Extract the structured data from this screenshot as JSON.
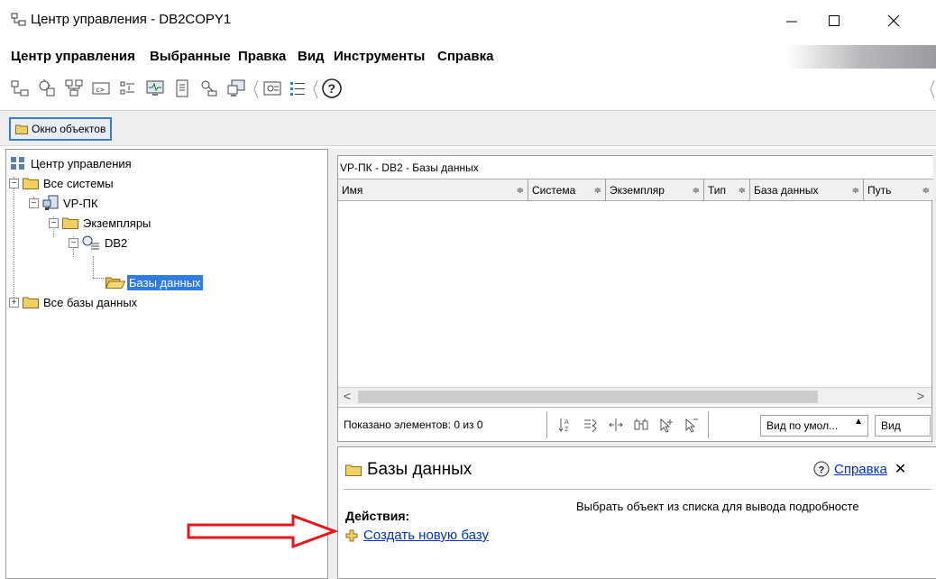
{
  "window": {
    "title": "Центр управления - DB2COPY1",
    "minimize_glyph": "—",
    "maximize_glyph": "☐",
    "close_glyph": "✕"
  },
  "menu": {
    "items": [
      "Центр управления",
      "Выбранные",
      "Правка",
      "Вид",
      "Инструменты",
      "Справка"
    ]
  },
  "toolbar": {
    "icons": [
      "control-center-icon",
      "replication-center-icon",
      "satellite-admin-icon",
      "command-editor-icon",
      "task-center-icon",
      "health-center-icon",
      "journal-icon",
      "license-center-icon",
      "configuration-assistant-icon",
      "tools-settings-icon",
      "legend-icon",
      "help-icon"
    ]
  },
  "object_window": {
    "button_label": "Окно объектов"
  },
  "tree": {
    "root": "Центр управления",
    "all_systems": "Все системы",
    "host": "VP-ПК",
    "instances": "Экземпляры",
    "instance": "DB2",
    "databases": "Базы данных",
    "all_databases": "Все базы данных"
  },
  "table": {
    "title": "VP-ПК - DB2 - Базы данных",
    "columns": [
      "Имя",
      "Система",
      "Экземпляр",
      "Тип",
      "База данных",
      "Путь"
    ],
    "sort_glyph": "≑"
  },
  "status": {
    "text": "Показано элементов: 0 из 0",
    "view_combo": "Вид по умол...",
    "view_button": "Вид"
  },
  "details": {
    "title": "Базы данных",
    "help_link": "Справка",
    "close_glyph": "✕",
    "actions_label": "Действия:",
    "create_link": "Создать новую базу",
    "hint": "Выбрать объект из списка для вывода подробносте"
  },
  "colors": {
    "selection": "#2f7de0",
    "link": "#0033cc",
    "folder": "#f2cf62",
    "annotation_arrow": "#e8151b"
  }
}
